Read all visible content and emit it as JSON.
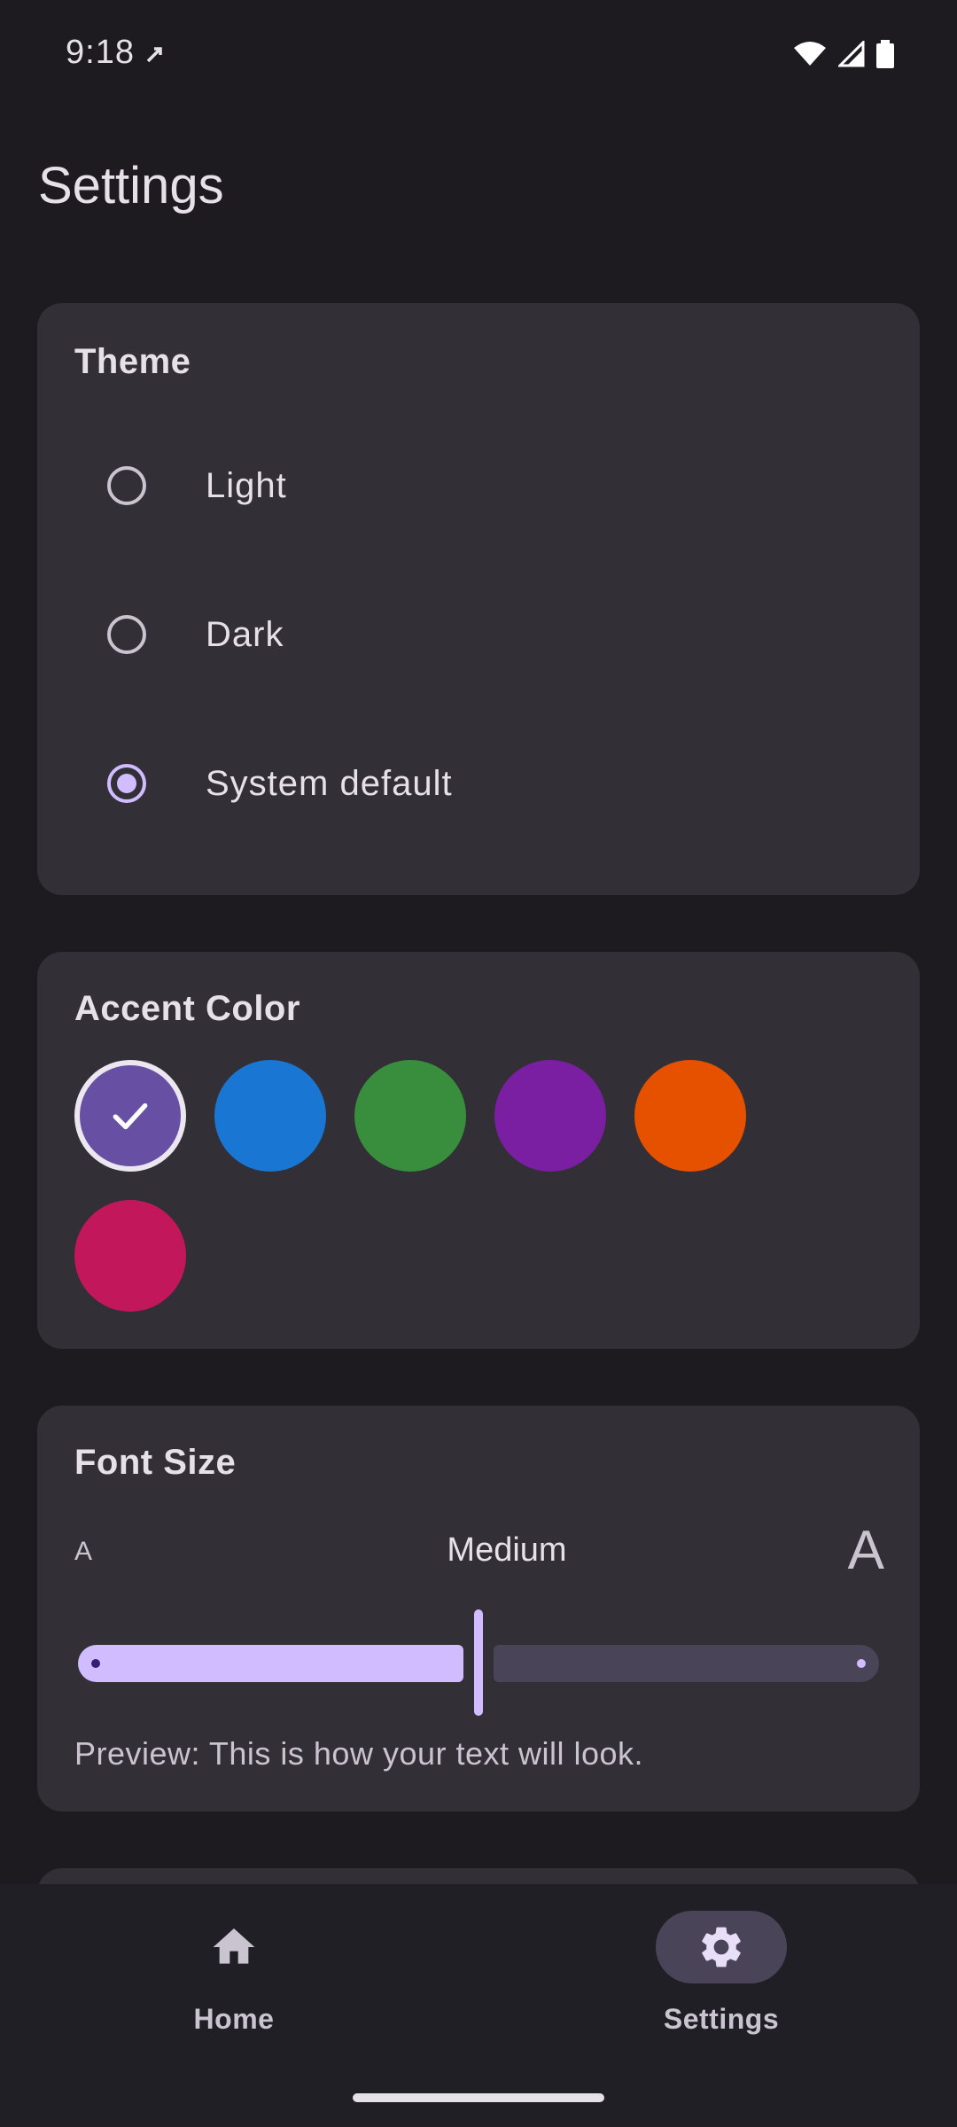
{
  "status_bar": {
    "time": "9:18"
  },
  "page": {
    "title": "Settings"
  },
  "theme": {
    "title": "Theme",
    "options": [
      {
        "label": "Light",
        "selected": false
      },
      {
        "label": "Dark",
        "selected": false
      },
      {
        "label": "System default",
        "selected": true
      }
    ]
  },
  "accent": {
    "title": "Accent Color",
    "swatches": [
      {
        "color": "#6750a4",
        "selected": true
      },
      {
        "color": "#1976d2",
        "selected": false
      },
      {
        "color": "#388e3c",
        "selected": false
      },
      {
        "color": "#7b1fa2",
        "selected": false
      },
      {
        "color": "#e65100",
        "selected": false
      },
      {
        "color": "#c2185b",
        "selected": false
      }
    ]
  },
  "font_size": {
    "title": "Font Size",
    "small_label": "A",
    "large_label": "A",
    "value": "Medium",
    "slider_fraction": 0.5,
    "preview": "Preview: This is how your text will look."
  },
  "nav": {
    "items": [
      {
        "label": "Home",
        "icon": "home-icon",
        "selected": false
      },
      {
        "label": "Settings",
        "icon": "gear-icon",
        "selected": true
      }
    ]
  },
  "colors": {
    "background": "#1d1b20",
    "card": "#322f37",
    "primary": "#d0bcff",
    "nav_indicator": "#4a4458"
  }
}
